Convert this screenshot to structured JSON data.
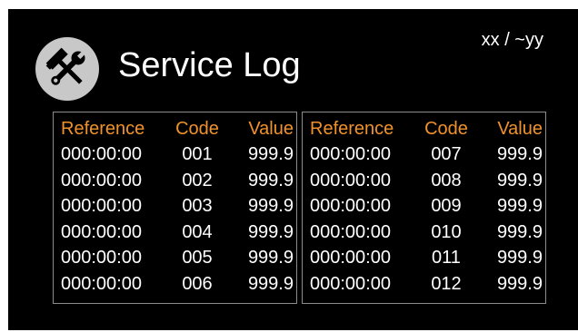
{
  "title": "Service Log",
  "pager": "xx / ~yy",
  "logo_icon": "hammer-wrench-icon",
  "colors": {
    "header": "#f0922c",
    "text": "#ffffff",
    "background": "#000000",
    "border": "#8c8c8c",
    "logo_bg": "#c8c8c8"
  },
  "columns": {
    "reference": "Reference",
    "code": "Code",
    "value": "Value"
  },
  "left_rows": [
    {
      "reference": "000:00:00",
      "code": "001",
      "value": "999.9"
    },
    {
      "reference": "000:00:00",
      "code": "002",
      "value": "999.9"
    },
    {
      "reference": "000:00:00",
      "code": "003",
      "value": "999.9"
    },
    {
      "reference": "000:00:00",
      "code": "004",
      "value": "999.9"
    },
    {
      "reference": "000:00:00",
      "code": "005",
      "value": "999.9"
    },
    {
      "reference": "000:00:00",
      "code": "006",
      "value": "999.9"
    }
  ],
  "right_rows": [
    {
      "reference": "000:00:00",
      "code": "007",
      "value": "999.9"
    },
    {
      "reference": "000:00:00",
      "code": "008",
      "value": "999.9"
    },
    {
      "reference": "000:00:00",
      "code": "009",
      "value": "999.9"
    },
    {
      "reference": "000:00:00",
      "code": "010",
      "value": "999.9"
    },
    {
      "reference": "000:00:00",
      "code": "011",
      "value": "999.9"
    },
    {
      "reference": "000:00:00",
      "code": "012",
      "value": "999.9"
    }
  ]
}
